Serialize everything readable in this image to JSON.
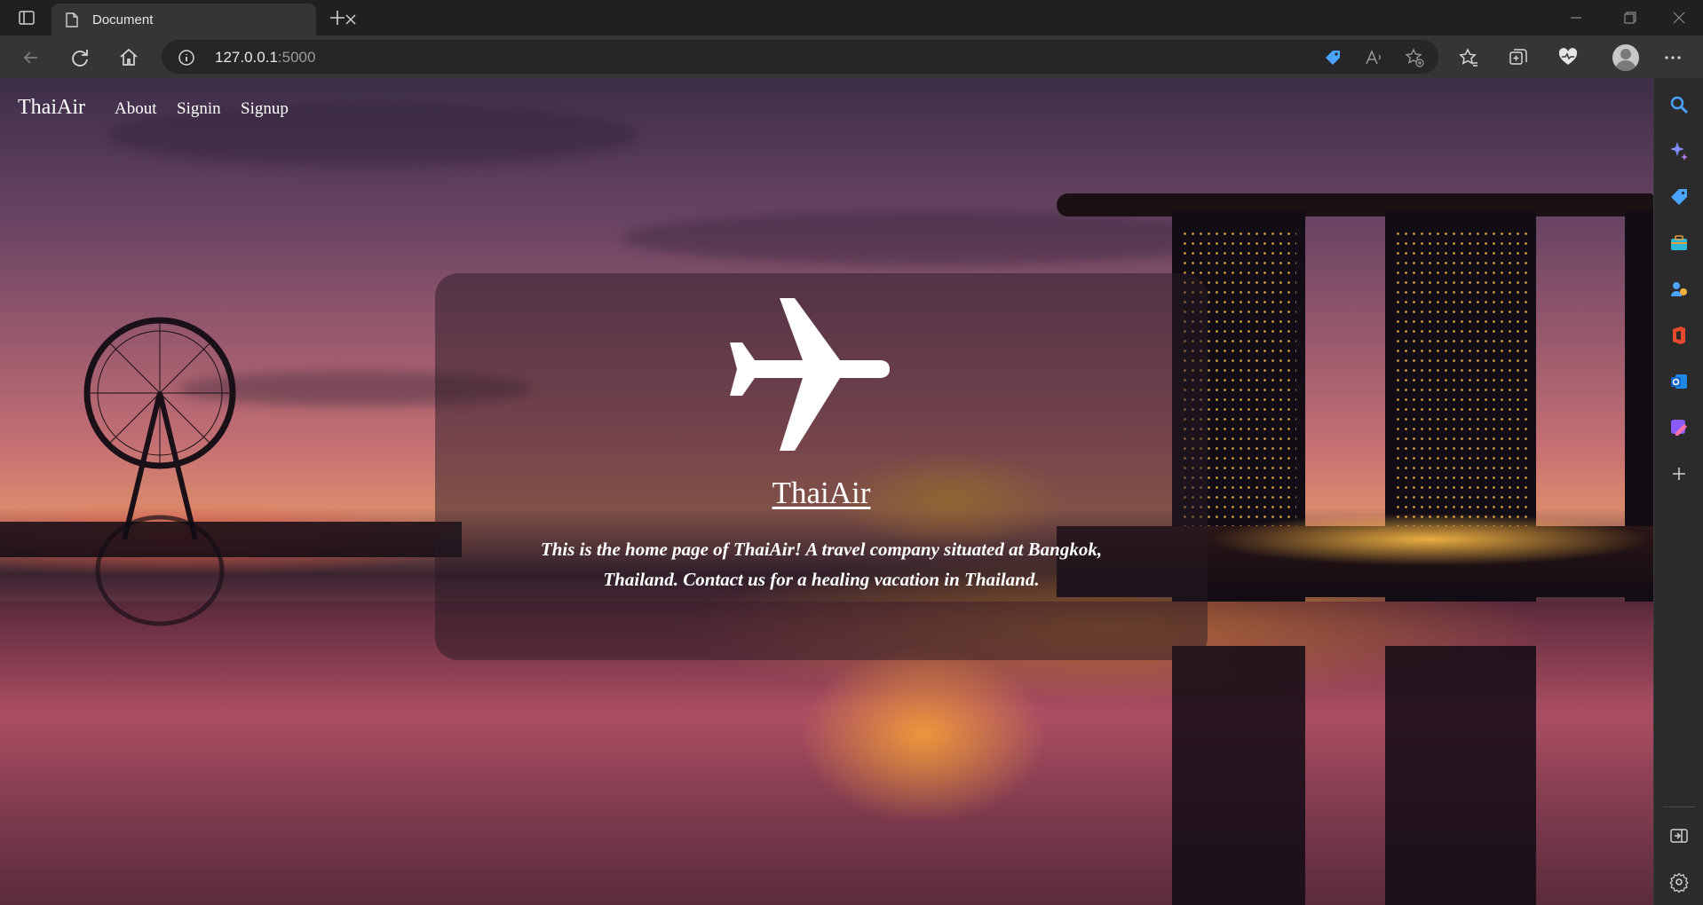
{
  "browser": {
    "tab_title": "Document",
    "url_host": "127.0.0.1",
    "url_port": ":5000"
  },
  "site": {
    "brand": "ThaiAir",
    "nav": [
      "About",
      "Signin",
      "Signup"
    ]
  },
  "hero": {
    "title": "ThaiAir",
    "description": "This is the home page of ThaiAir! A travel company situated at Bangkok, Thailand. Contact us for a healing vacation in Thailand."
  },
  "icons": {
    "hero": "airplane-icon"
  },
  "colors": {
    "text": "#ffffff",
    "panel": "rgba(40,25,35,0.5)",
    "chrome_bg": "#202020",
    "toolbar_bg": "#353535"
  }
}
